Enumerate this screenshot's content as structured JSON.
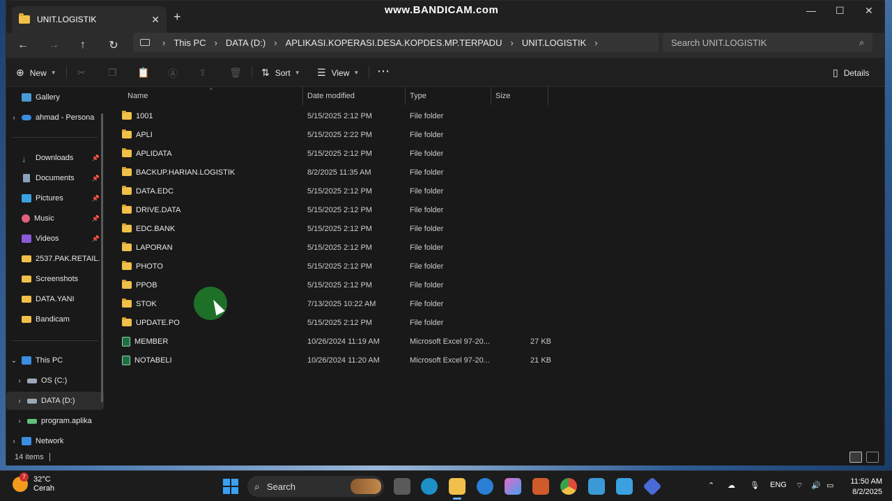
{
  "window": {
    "tab_title": "UNIT.LOGISTIK",
    "watermark": "www.BANDICAM.com"
  },
  "address": {
    "crumbs": [
      "This PC",
      "DATA (D:)",
      "APLIKASI.KOPERASI.DESA.KOPDES.MP.TERPADU",
      "UNIT.LOGISTIK"
    ],
    "search_placeholder": "Search UNIT.LOGISTIK"
  },
  "toolbar": {
    "new_label": "New",
    "sort_label": "Sort",
    "view_label": "View",
    "details_label": "Details"
  },
  "sidebar": {
    "items": [
      {
        "label": "Gallery"
      },
      {
        "label": "ahmad - Persona"
      },
      {
        "label": "Downloads"
      },
      {
        "label": "Documents"
      },
      {
        "label": "Pictures"
      },
      {
        "label": "Music"
      },
      {
        "label": "Videos"
      },
      {
        "label": "2537.PAK.RETAIL."
      },
      {
        "label": "Screenshots"
      },
      {
        "label": "DATA.YANI"
      },
      {
        "label": "Bandicam"
      },
      {
        "label": "This PC"
      },
      {
        "label": "OS (C:)"
      },
      {
        "label": "DATA (D:)"
      },
      {
        "label": "program.aplika"
      },
      {
        "label": "Network"
      }
    ]
  },
  "columns": {
    "name": "Name",
    "date": "Date modified",
    "type": "Type",
    "size": "Size"
  },
  "files": [
    {
      "name": "1001",
      "date": "5/15/2025 2:12 PM",
      "type": "File folder",
      "size": ""
    },
    {
      "name": "APLI",
      "date": "5/15/2025 2:22 PM",
      "type": "File folder",
      "size": ""
    },
    {
      "name": "APLIDATA",
      "date": "5/15/2025 2:12 PM",
      "type": "File folder",
      "size": ""
    },
    {
      "name": "BACKUP.HARIAN.LOGISTIK",
      "date": "8/2/2025 11:35 AM",
      "type": "File folder",
      "size": ""
    },
    {
      "name": "DATA.EDC",
      "date": "5/15/2025 2:12 PM",
      "type": "File folder",
      "size": ""
    },
    {
      "name": "DRIVE.DATA",
      "date": "5/15/2025 2:12 PM",
      "type": "File folder",
      "size": ""
    },
    {
      "name": "EDC.BANK",
      "date": "5/15/2025 2:12 PM",
      "type": "File folder",
      "size": ""
    },
    {
      "name": "LAPORAN",
      "date": "5/15/2025 2:12 PM",
      "type": "File folder",
      "size": ""
    },
    {
      "name": "PHOTO",
      "date": "5/15/2025 2:12 PM",
      "type": "File folder",
      "size": ""
    },
    {
      "name": "PPOB",
      "date": "5/15/2025 2:12 PM",
      "type": "File folder",
      "size": ""
    },
    {
      "name": "STOK",
      "date": "7/13/2025 10:22 AM",
      "type": "File folder",
      "size": ""
    },
    {
      "name": "UPDATE.PO",
      "date": "5/15/2025 2:12 PM",
      "type": "File folder",
      "size": ""
    },
    {
      "name": "MEMBER",
      "date": "10/26/2024 11:19 AM",
      "type": "Microsoft Excel 97-20...",
      "size": "27 KB"
    },
    {
      "name": "NOTABELI",
      "date": "10/26/2024 11:20 AM",
      "type": "Microsoft Excel 97-20...",
      "size": "21 KB"
    }
  ],
  "status": {
    "count": "14 items"
  },
  "taskbar": {
    "temp": "32°C",
    "weather": "Cerah",
    "weather_badge": "7",
    "search_label": "Search",
    "lang": "ENG",
    "time": "11:50 AM",
    "date": "8/2/2025"
  }
}
